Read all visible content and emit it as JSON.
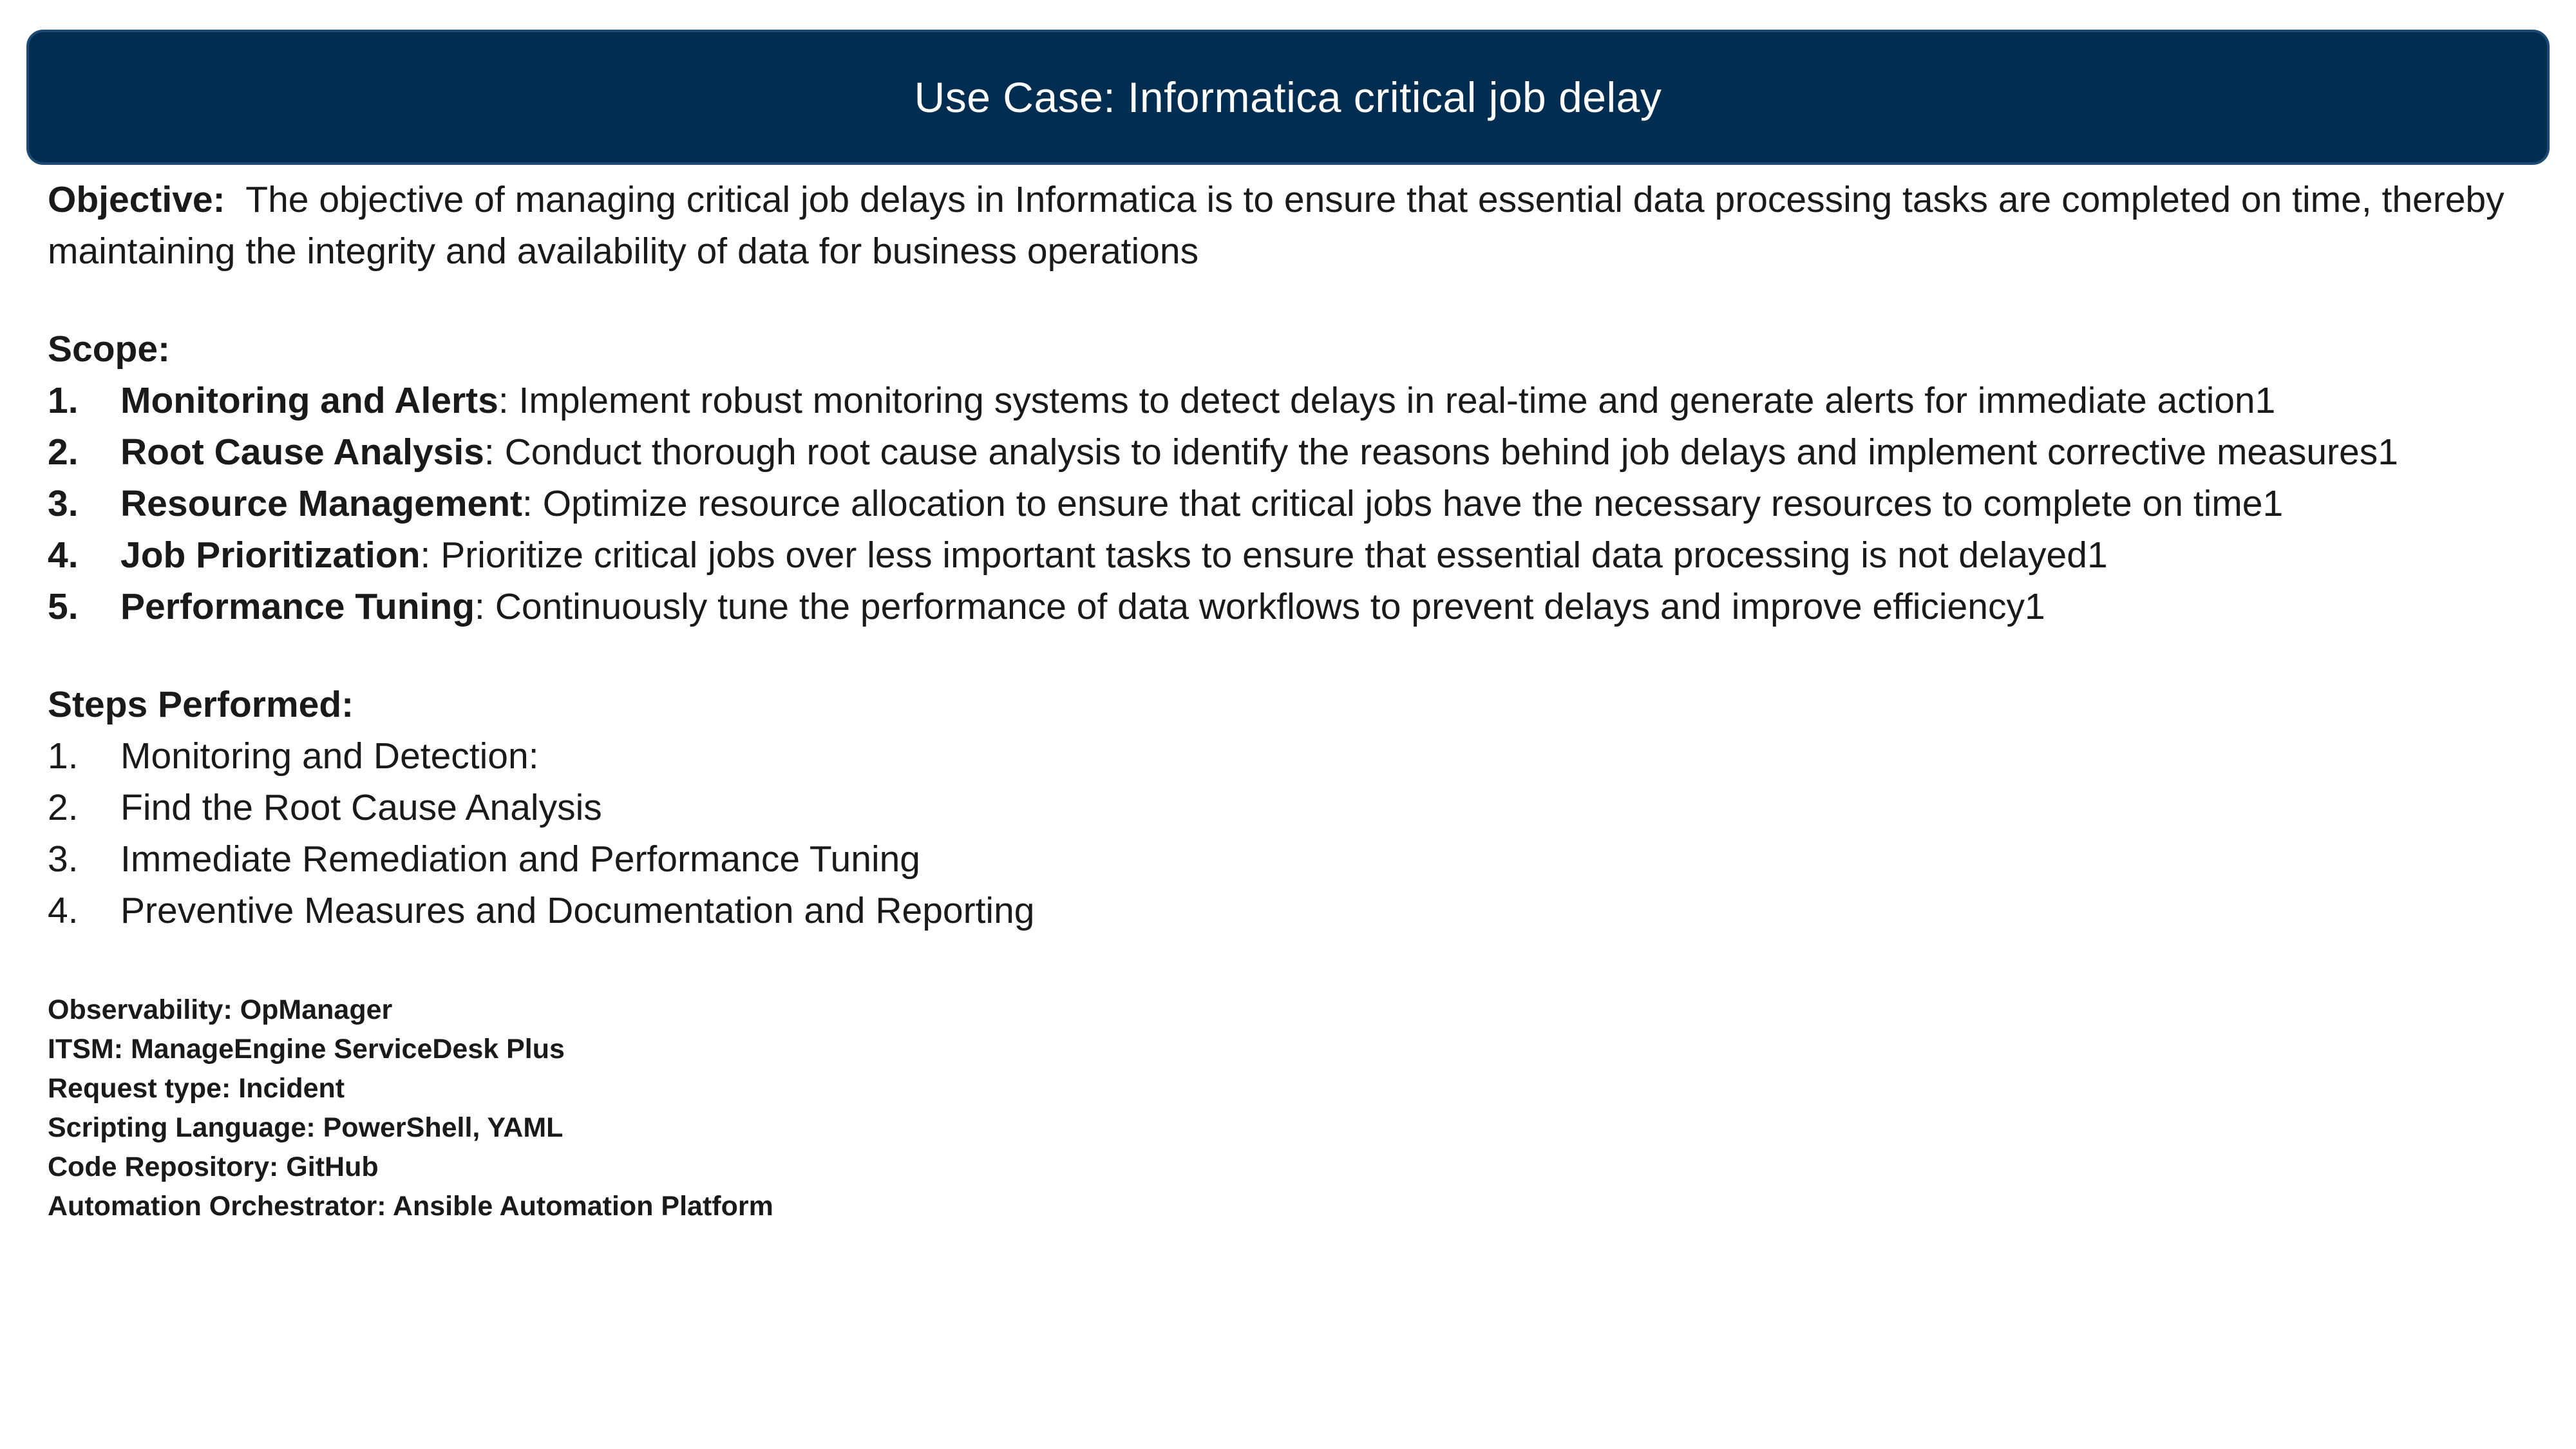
{
  "banner": {
    "title": "Use Case: Informatica critical job delay",
    "background_color": "#002d50"
  },
  "objective": {
    "label": "Objective:",
    "text": "The objective of managing critical job delays in Informatica is to ensure that essential data processing tasks are completed on time, thereby maintaining the integrity and availability of data for business operations"
  },
  "scope": {
    "heading": "Scope:",
    "items": [
      {
        "num": "1.",
        "term": "Monitoring and Alerts",
        "desc": ": Implement robust monitoring systems to detect delays in real-time and generate alerts for immediate action1"
      },
      {
        "num": "2.",
        "term": "Root Cause Analysis",
        "desc": ": Conduct thorough root cause analysis to identify the reasons behind job delays and implement corrective measures1"
      },
      {
        "num": "3.",
        "term": "Resource Management",
        "desc": ": Optimize resource allocation to ensure that critical jobs have the necessary resources to complete on time1"
      },
      {
        "num": "4.",
        "term": "Job Prioritization",
        "desc": ": Prioritize critical jobs over less important tasks to ensure that essential data processing is not delayed1"
      },
      {
        "num": "5.",
        "term": "Performance Tuning",
        "desc": ": Continuously tune the performance of data workflows to prevent delays and improve efficiency1"
      }
    ]
  },
  "steps": {
    "heading": "Steps Performed:",
    "items": [
      {
        "num": "1.",
        "text": "Monitoring and Detection:"
      },
      {
        "num": "2.",
        "text": "Find the Root Cause Analysis"
      },
      {
        "num": "3.",
        "text": "Immediate Remediation and Performance Tuning"
      },
      {
        "num": "4.",
        "text": "Preventive Measures and Documentation and Reporting"
      }
    ]
  },
  "details": [
    "Observability: OpManager",
    "ITSM: ManageEngine ServiceDesk Plus",
    "Request type: Incident",
    "Scripting Language: PowerShell, YAML",
    "Code Repository: GitHub",
    "Automation Orchestrator: Ansible Automation Platform"
  ]
}
